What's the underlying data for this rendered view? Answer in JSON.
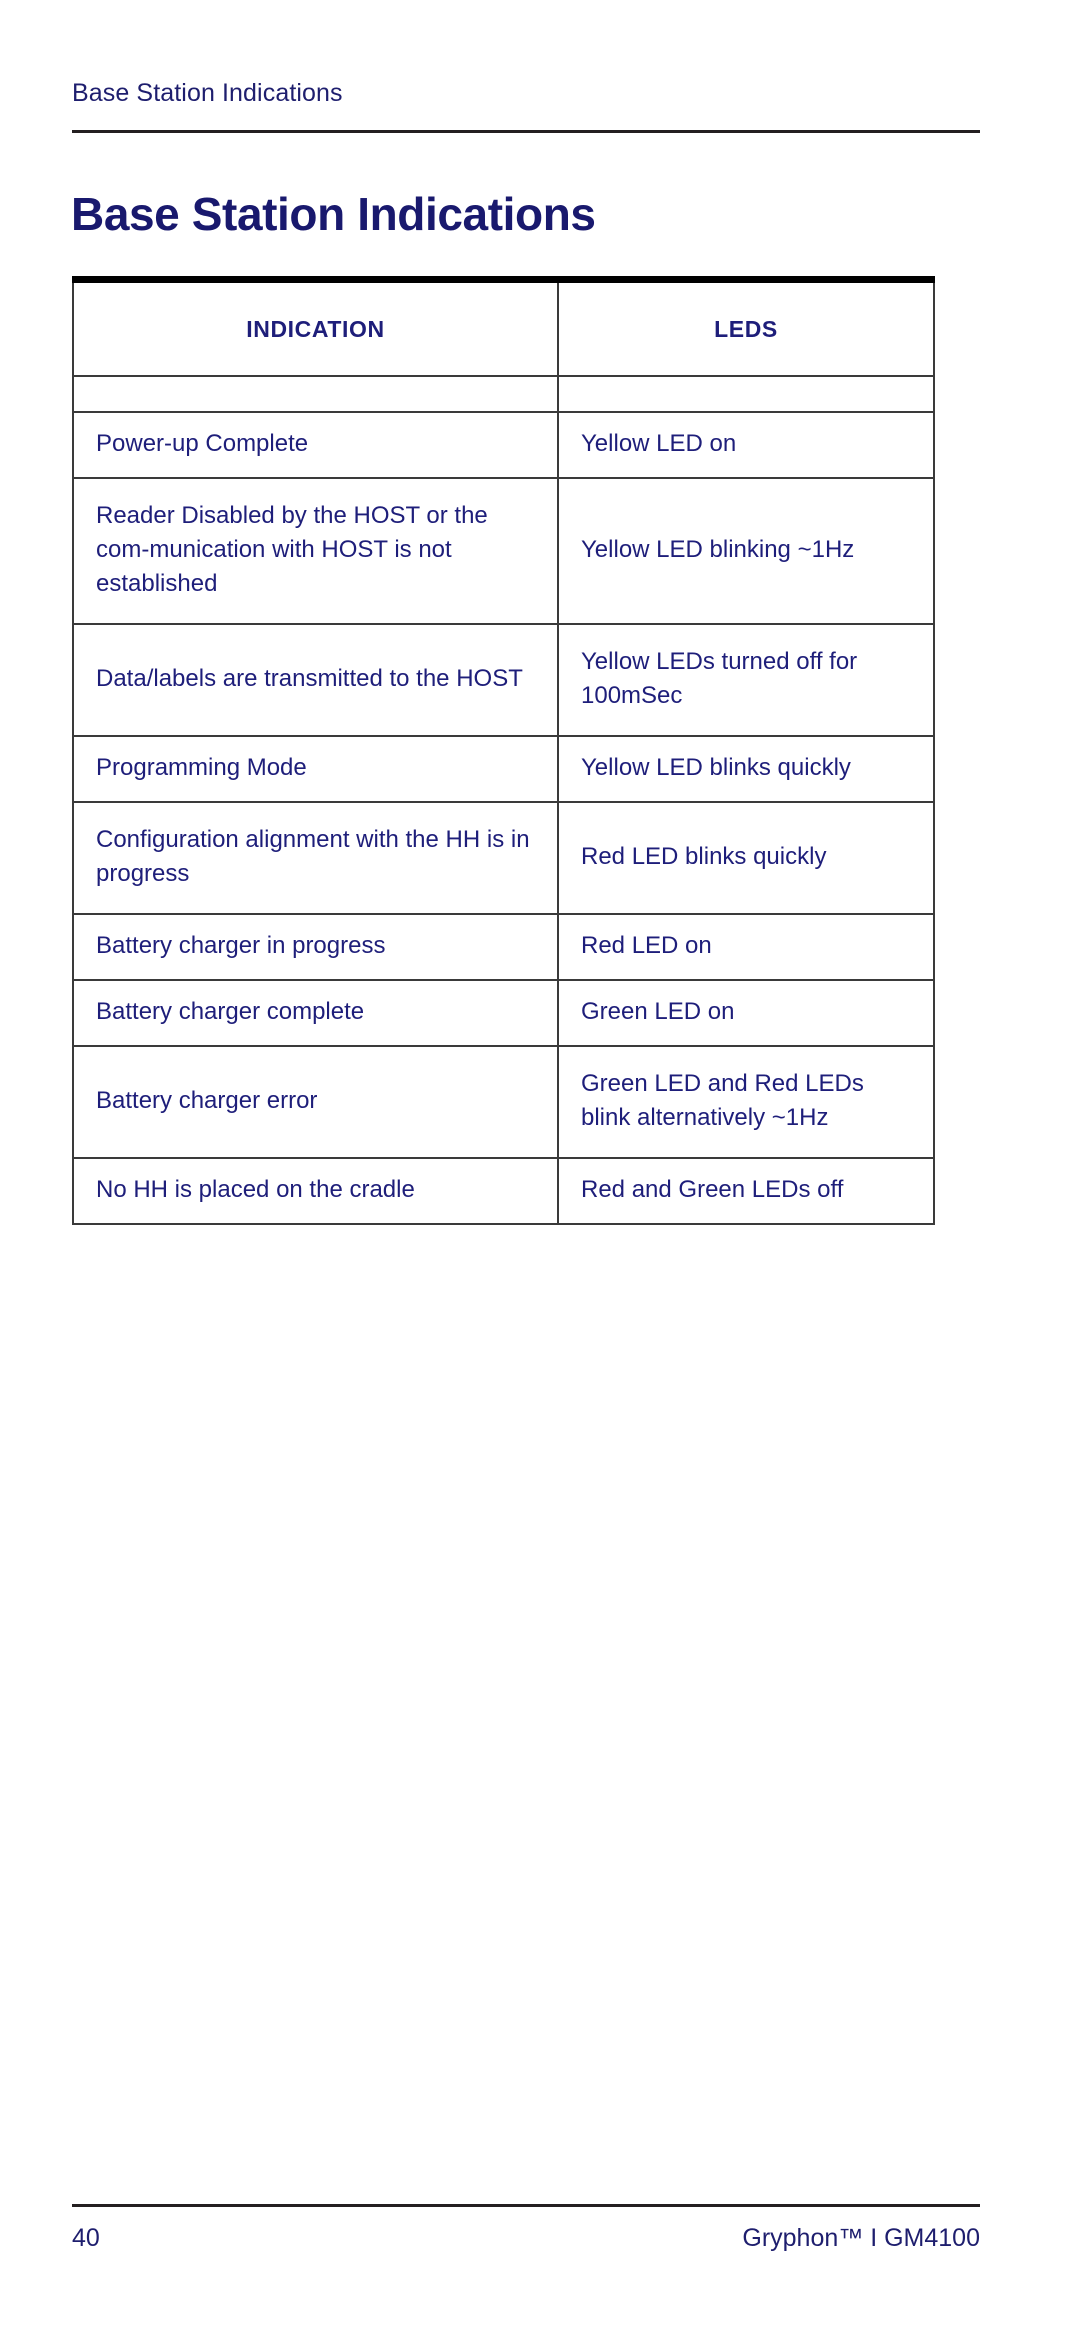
{
  "document": {
    "running_header": "Base Station Indications",
    "title": "Base Station Indications",
    "accent_color": "#19196e",
    "rule_color": "#231f20"
  },
  "table": {
    "columns": [
      {
        "key": "indication",
        "label": "INDICATION"
      },
      {
        "key": "leds",
        "label": "LEDS"
      }
    ],
    "rows": [
      {
        "indication": "Power-up Complete",
        "leds": "Yellow LED on"
      },
      {
        "indication": "Reader Disabled by the HOST or the com-munication with HOST is not established",
        "leds": "Yellow LED blinking ~1Hz"
      },
      {
        "indication": "Data/labels are transmitted to the HOST",
        "leds": "Yellow LEDs turned off for 100mSec"
      },
      {
        "indication": "Programming Mode",
        "leds": "Yellow LED blinks quickly"
      },
      {
        "indication": "Configuration alignment with the HH is in progress",
        "leds": "Red LED blinks quickly"
      },
      {
        "indication": "Battery charger in progress",
        "leds": "Red LED on"
      },
      {
        "indication": "Battery charger complete",
        "leds": "Green LED on"
      },
      {
        "indication": "Battery charger error",
        "leds": "Green LED and Red LEDs blink alternatively ~1Hz"
      },
      {
        "indication": "No HH is placed on the cradle",
        "leds": "Red and Green LEDs off"
      }
    ]
  },
  "footer": {
    "page_number": "40",
    "product": "Gryphon™ I GM4100"
  }
}
